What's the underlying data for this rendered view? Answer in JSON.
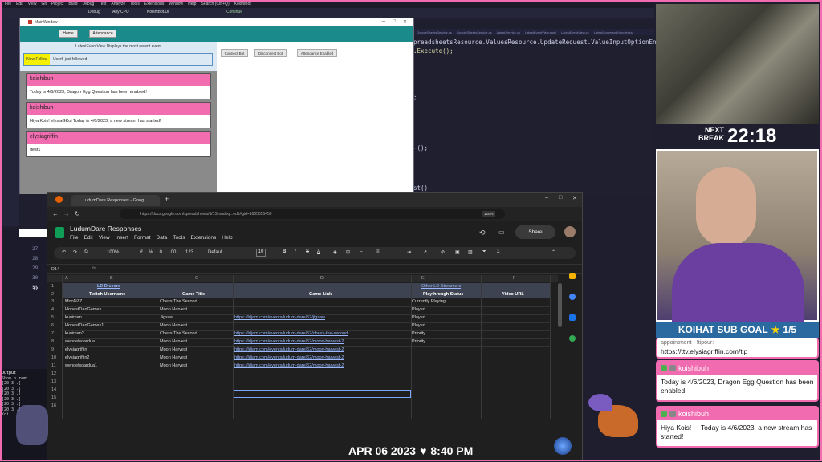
{
  "vs": {
    "menu": [
      "File",
      "Edit",
      "View",
      "Git",
      "Project",
      "Build",
      "Debug",
      "Test",
      "Analyze",
      "Tools",
      "Extensions",
      "Window",
      "Help",
      "Search (Ctrl+Q)",
      "KoishiBot"
    ],
    "toolbar": {
      "config": "Debug",
      "platform": "Any CPU",
      "project": "KoishiBot.UI",
      "run_label": "Continue"
    },
    "tabs": [
      "GoogleSheetsService.cs",
      "GoogleSheetsService.cs",
      "LatestService.cs",
      "LatestEventView.xaml",
      "LatestEventView.cs",
      "LatestCommandHandler.cs"
    ],
    "code": [
      "preadsheetsResource.ValuesResource.UpdateRequest.ValueInputOptionEnum.U",
      ".Execute();",
      ";",
      "-();",
      "st()"
    ],
    "linenums": [
      "27",
      "28",
      "29",
      "30",
      "31",
      "32"
    ],
    "output_label": "Output",
    "output_lines": [
      "Show o  rom:",
      "[20:3  .]",
      "[20:3  .]",
      "[20:3  .]",
      "[20:3  .]",
      "[20:3  .]",
      "[20:3  .]",
      "Koi"
    ]
  },
  "wpf": {
    "title": "MainWindow",
    "nav": {
      "home": "Home",
      "attendance": "Attendance"
    },
    "latest_title": "LatestEventView Displays the most recent event",
    "latest_tag": "New Follow",
    "latest_text": "User5 just followed",
    "buttons": {
      "connect": "Connect Bot",
      "disconnect": "Disconnect Bot",
      "attendance": "Attendance Enabled"
    },
    "cards": [
      {
        "user": "koishibuh",
        "message": "Today is 4/6/2023, Dragon Egg Question has been enabled!"
      },
      {
        "user": "koishibuh",
        "message": "Hiya Kois! elysiaGKoi Today is 4/6/2023, a new stream has started!"
      },
      {
        "user": "elysiagriffin",
        "message": "!test1"
      }
    ]
  },
  "sheets": {
    "tab_title": "LudumDare Responses - Googl",
    "url": "https://docs.google.com/spreadsheets/d/1Shmdoq...edit#gid=1605055459",
    "zoom_badge": "120%",
    "doc_title": "LudumDare Responses",
    "share_label": "Share",
    "menu": [
      "File",
      "Edit",
      "View",
      "Insert",
      "Format",
      "Data",
      "Tools",
      "Extensions",
      "Help"
    ],
    "toolbar": {
      "zoom": "100%",
      "font": "Defaul...",
      "size": "10",
      "currency": "£",
      "percent": "%",
      "decimals": ".0",
      "dec_more": ".00",
      "num": "123"
    },
    "name_box": "D14",
    "fx": "fx",
    "col_letters": [
      "A",
      "B",
      "C",
      "D",
      "E",
      "F"
    ],
    "row1": {
      "b": "LD Discord",
      "e": "Other LD Streamers"
    },
    "headers": [
      "Twitch Username",
      "Game Title",
      "Game Link",
      "Playthrough Status",
      "Video URL"
    ],
    "rows": [
      {
        "n": "3",
        "user": "MooNZZ",
        "game": "Chess The Second",
        "link": "",
        "status": "Currently Playing"
      },
      {
        "n": "4",
        "user": "HonestDanGames",
        "game": "Moon Harvest",
        "link": "",
        "status": "Played"
      },
      {
        "n": "5",
        "user": "kuuiman",
        "game": "Jigsaw",
        "link": "https://ldjam.com/events/ludum-dare/52/jigsaw",
        "status": "Played"
      },
      {
        "n": "6",
        "user": "HonestDanGames1",
        "game": "Moon Harvest",
        "link": "",
        "status": "Played"
      },
      {
        "n": "7",
        "user": "kuuiman2",
        "game": "Chess The Second",
        "link": "https://ldjam.com/events/ludum-dare/52/chess-the-second",
        "status": "Priority"
      },
      {
        "n": "8",
        "user": "wendelscardua",
        "game": "Moon Harvest",
        "link": "https://ldjam.com/events/ludum-dare/52/moon-harvest-2",
        "status": "Priority"
      },
      {
        "n": "9",
        "user": "elysiagriffin",
        "game": "Moon Harvest",
        "link": "https://ldjam.com/events/ludum-dare/52/moon-harvest-2",
        "status": ""
      },
      {
        "n": "10",
        "user": "elysiagriffin2",
        "game": "Moon Harvest",
        "link": "https://ldjam.com/events/ludum-dare/52/moon-harvest-2",
        "status": ""
      },
      {
        "n": "11",
        "user": "wendelscardua1",
        "game": "Moon Harvest",
        "link": "https://ldjam.com/events/ludum-dare/52/moon-harvest-2",
        "status": ""
      }
    ],
    "empty_rows": [
      "12",
      "13",
      "14",
      "15",
      "16"
    ]
  },
  "overlay": {
    "next_break_label1": "NEXT",
    "next_break_label2": "BREAK",
    "next_break_time": "22:18",
    "goal_label": "KOIHAT SUB GOAL",
    "goal_value": "1/5",
    "goal_progress": 0.2,
    "partial_chat": "appointment - !tipour:",
    "partial_link": "https://ttv.elysiagriffin.com/tip",
    "chats": [
      {
        "user": "koishibuh",
        "message": "Today is 4/6/2023, Dragon Egg Question has been enabled!"
      },
      {
        "user": "koishibuh",
        "message": "Hiya Kois!     Today is 4/6/2023, a new stream has started!"
      }
    ],
    "date": "APR 06 2023",
    "time": "8:40 PM"
  },
  "colors": {
    "pink": "#f06bb0",
    "teal": "#1a8a8a",
    "sheets_bg": "#1f1f1f",
    "link": "#9ab8ff"
  }
}
